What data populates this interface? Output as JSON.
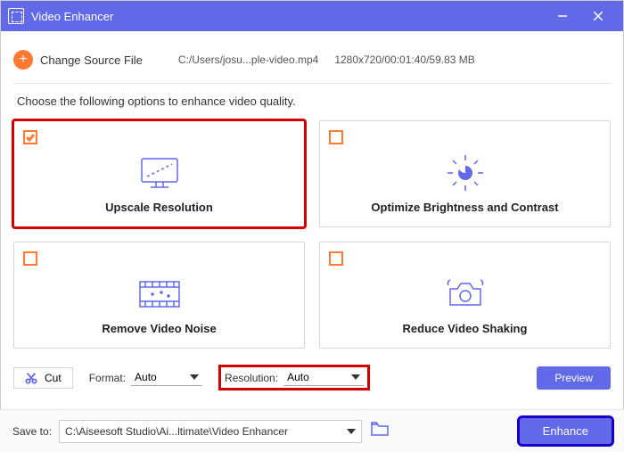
{
  "window": {
    "title": "Video Enhancer"
  },
  "source": {
    "change_label": "Change Source File",
    "path": "C:/Users/josu...ple-video.mp4",
    "meta": "1280x720/00:01:40/59.83 MB"
  },
  "instruction": "Choose the following options to enhance video quality.",
  "cards": {
    "upscale": {
      "label": "Upscale Resolution",
      "checked": true
    },
    "brightness": {
      "label": "Optimize Brightness and Contrast",
      "checked": false
    },
    "noise": {
      "label": "Remove Video Noise",
      "checked": false
    },
    "shaking": {
      "label": "Reduce Video Shaking",
      "checked": false
    }
  },
  "controls": {
    "cut_label": "Cut",
    "format_label": "Format:",
    "format_value": "Auto",
    "resolution_label": "Resolution:",
    "resolution_value": "Auto",
    "preview_label": "Preview"
  },
  "saveto": {
    "label": "Save to:",
    "path": "C:\\Aiseesoft Studio\\Ai...ltimate\\Video Enhancer"
  },
  "enhance_label": "Enhance"
}
